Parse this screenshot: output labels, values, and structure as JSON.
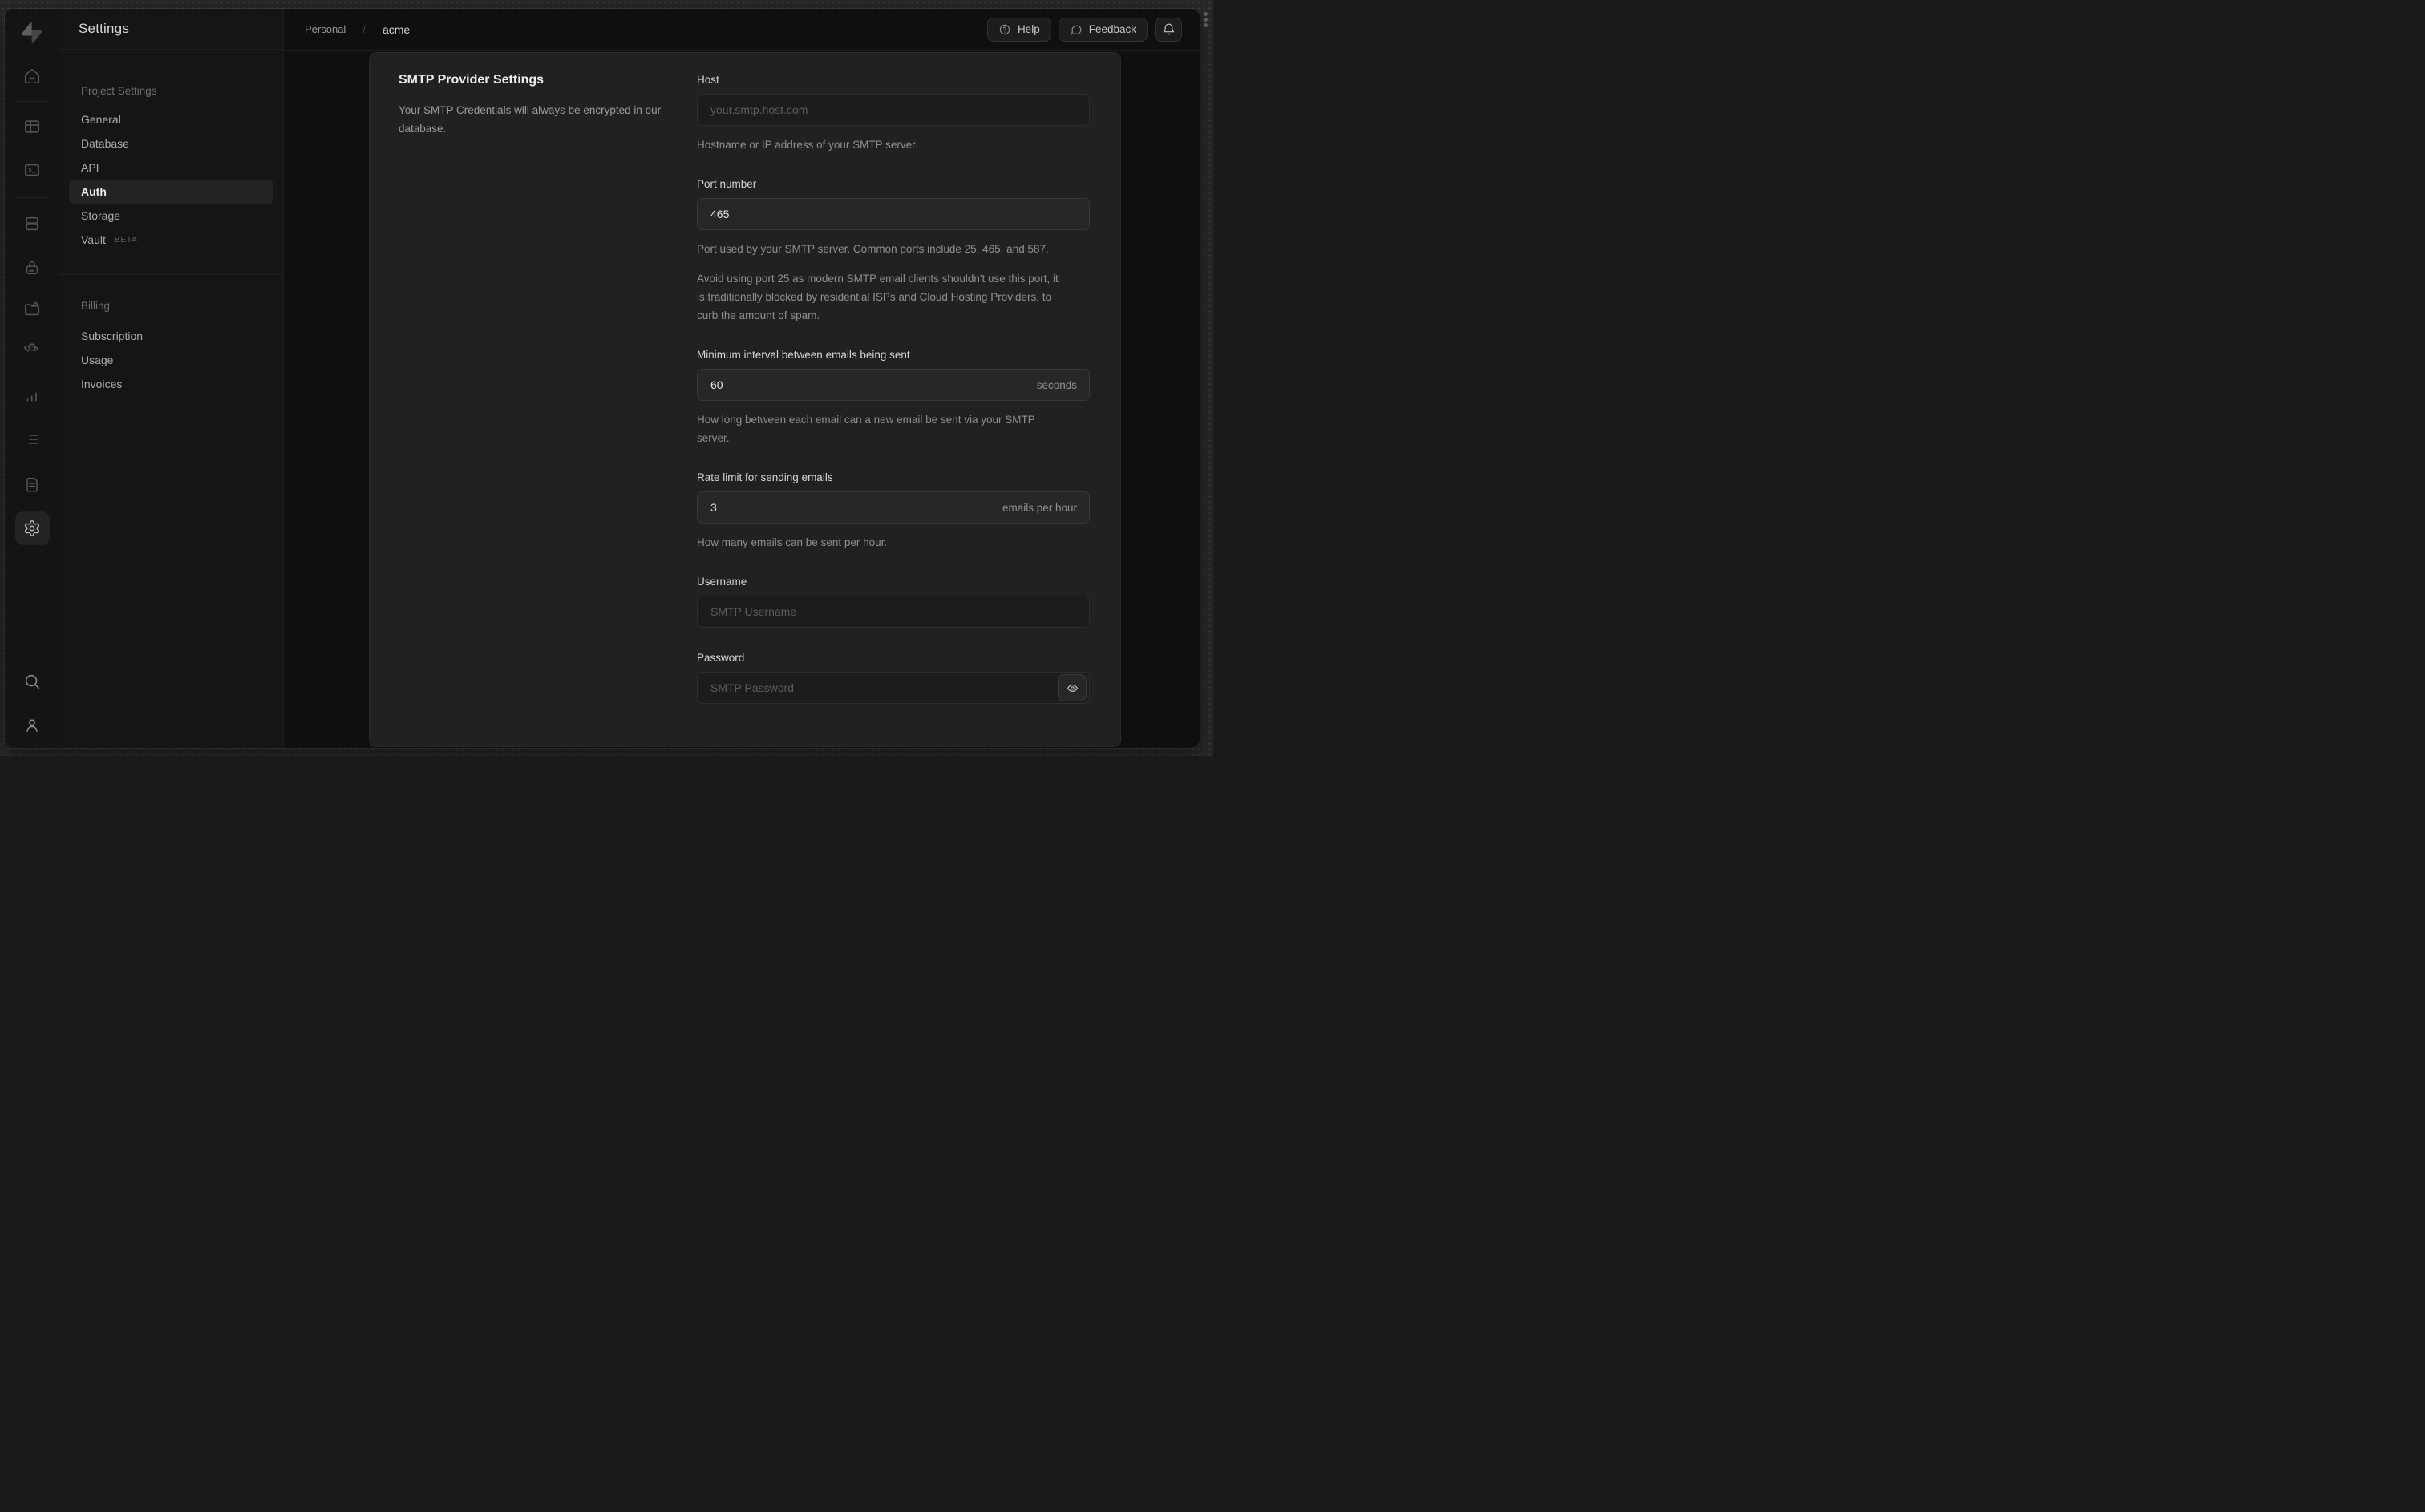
{
  "rail": {
    "logo": "supabase-logo",
    "items": [
      "home",
      "table-editor",
      "sql-editor",
      "database",
      "authentication",
      "storage",
      "edge-functions",
      "reports",
      "logs",
      "api-docs",
      "project-settings",
      "search",
      "account"
    ],
    "active_item": "project-settings"
  },
  "nav": {
    "title": "Settings",
    "sections": [
      {
        "header": "Project Settings",
        "items": [
          {
            "label": "General"
          },
          {
            "label": "Database"
          },
          {
            "label": "API"
          },
          {
            "label": "Auth",
            "active": true
          },
          {
            "label": "Storage"
          },
          {
            "label": "Vault",
            "badge": "BETA"
          }
        ]
      },
      {
        "header": "Billing",
        "items": [
          {
            "label": "Subscription"
          },
          {
            "label": "Usage"
          },
          {
            "label": "Invoices"
          }
        ]
      }
    ]
  },
  "header": {
    "breadcrumb": {
      "org": "Personal",
      "separator": "/",
      "project": "acme"
    },
    "help_label": "Help",
    "feedback_label": "Feedback"
  },
  "panel": {
    "title": "SMTP Provider Settings",
    "description": "Your SMTP Credentials will always be encrypted in our database.",
    "fields": [
      {
        "label": "Host",
        "placeholder": "your.smtp.host.com",
        "helper": "Hostname or IP address of your SMTP server."
      },
      {
        "label": "Port number",
        "value": "465",
        "helper": "Port used by your SMTP server. Common ports include 25, 465, and 587.",
        "helper2": "Avoid using port 25 as modern SMTP email clients shouldn't use this port, it is traditionally blocked by residential ISPs and Cloud Hosting Providers, to curb the amount of spam."
      },
      {
        "label": "Minimum interval between emails being sent",
        "value": "60",
        "suffix": "seconds",
        "helper": "How long between each email can a new email be sent via your SMTP server."
      },
      {
        "label": "Rate limit for sending emails",
        "value": "3",
        "suffix": "emails per hour",
        "helper": "How many emails can be sent per hour."
      },
      {
        "label": "Username",
        "placeholder": "SMTP Username"
      },
      {
        "label": "Password",
        "placeholder": "SMTP Password"
      }
    ]
  },
  "colors": {
    "desktop_bg": "#292929",
    "window_bg": "#0f0f0f",
    "nav_bg": "#151515",
    "card_bg": "#212121",
    "active_pill": "#232323",
    "text_primary": "#ececec",
    "text_muted": "#8f8f8f"
  }
}
